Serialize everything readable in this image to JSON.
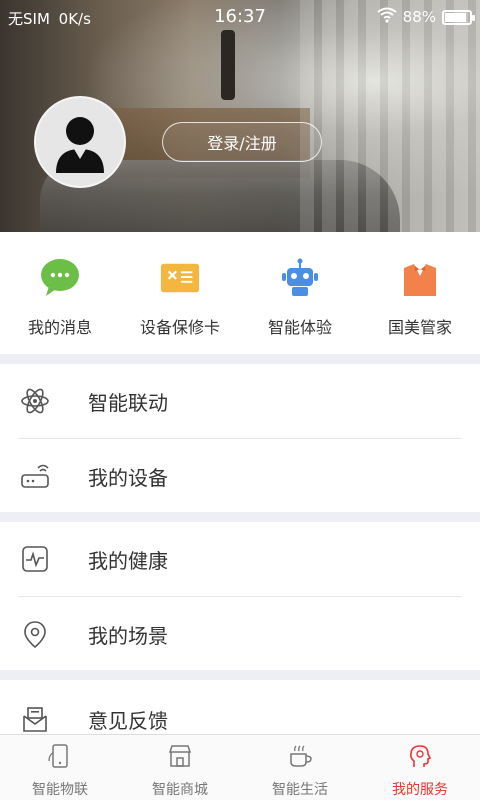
{
  "status": {
    "carrier": "无SIM",
    "speed": "0K/s",
    "time": "16:37",
    "battery": "88%",
    "battery_level": 0.88
  },
  "header": {
    "login_label": "登录/注册"
  },
  "quick_actions": [
    {
      "label": "我的消息",
      "icon": "message-bubble-icon",
      "color": "#6cbf46"
    },
    {
      "label": "设备保修卡",
      "icon": "warranty-card-icon",
      "color": "#f3b63e"
    },
    {
      "label": "智能体验",
      "icon": "robot-icon",
      "color": "#4a8ee6"
    },
    {
      "label": "国美管家",
      "icon": "butler-icon",
      "color": "#f3824a"
    }
  ],
  "menu": {
    "group1": [
      {
        "label": "智能联动",
        "icon": "atom-icon"
      },
      {
        "label": "我的设备",
        "icon": "router-icon"
      }
    ],
    "group2": [
      {
        "label": "我的健康",
        "icon": "health-pulse-icon"
      },
      {
        "label": "我的场景",
        "icon": "location-pin-icon"
      }
    ],
    "group3": [
      {
        "label": "意见反馈",
        "icon": "feedback-envelope-icon"
      }
    ]
  },
  "bottom_nav": [
    {
      "label": "智能物联",
      "icon": "phone-icon",
      "active": false
    },
    {
      "label": "智能商城",
      "icon": "store-icon",
      "active": false
    },
    {
      "label": "智能生活",
      "icon": "coffee-cup-icon",
      "active": false
    },
    {
      "label": "我的服务",
      "icon": "profile-head-icon",
      "active": true
    }
  ],
  "colors": {
    "accent": "#e33333",
    "section_bg": "#eeeef5"
  }
}
